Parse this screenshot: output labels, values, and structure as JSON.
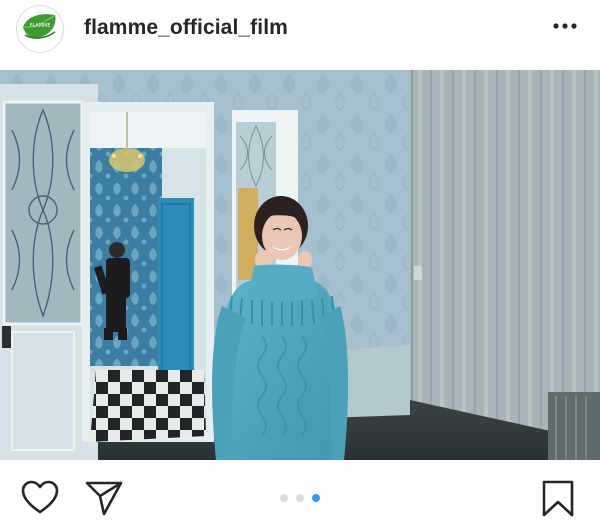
{
  "header": {
    "username": "flamme_official_film",
    "avatar_icon": "leaf-logo-icon",
    "avatar_logo_text": "FLAMME",
    "more_icon": "more-horizontal-icon"
  },
  "photo": {
    "kind": "film-photo-woman-in-turquoise-sweater"
  },
  "actions": {
    "like_icon": "heart-icon",
    "share_icon": "paper-plane-icon",
    "save_icon": "bookmark-icon"
  },
  "carousel": {
    "total": 3,
    "current": 3,
    "active_color": "#3897f0",
    "inactive_color": "#dbdbdb"
  }
}
